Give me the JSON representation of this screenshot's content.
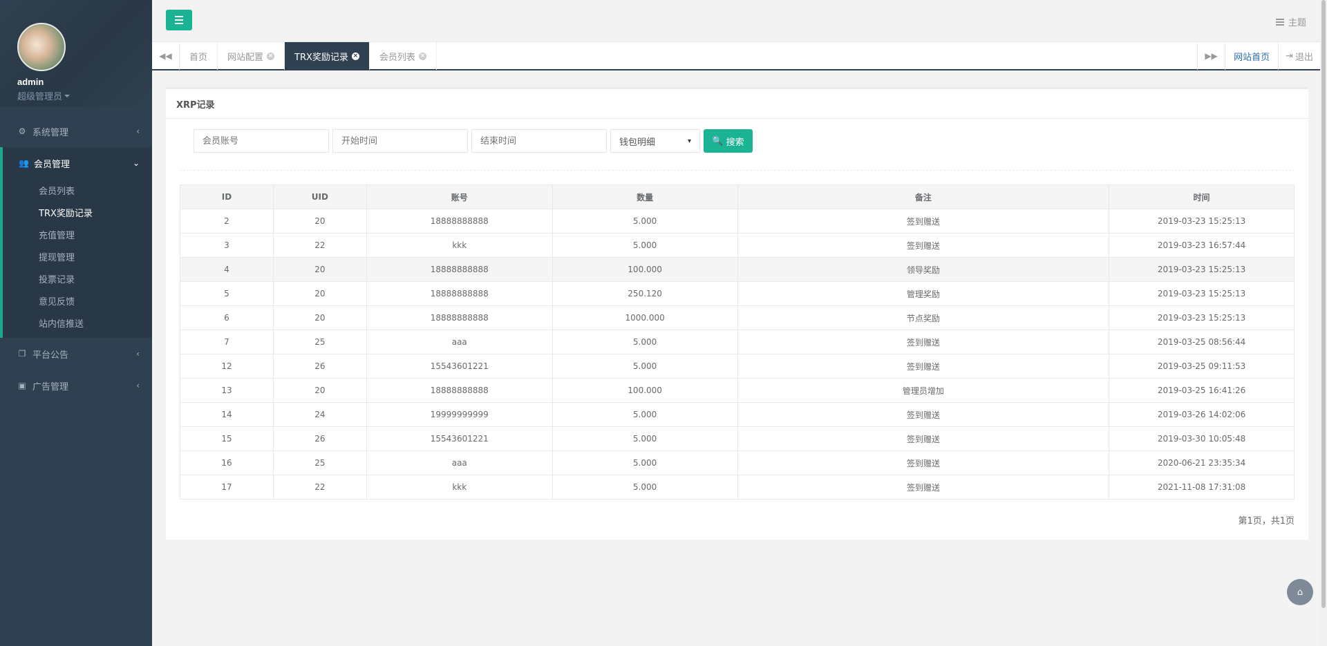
{
  "sidebar": {
    "username": "admin",
    "role": "超级管理员",
    "menu_system": "系统管理",
    "menu_member": "会员管理",
    "sub_items": [
      "会员列表",
      "TRX奖励记录",
      "充值管理",
      "提现管理",
      "投票记录",
      "意见反馈",
      "站内信推送"
    ],
    "menu_notice": "平台公告",
    "menu_ads": "广告管理"
  },
  "header": {
    "theme_label": "主题"
  },
  "tabs": {
    "items": [
      "首页",
      "网站配置",
      "TRX奖励记录",
      "会员列表"
    ],
    "active_index": 2,
    "home_link": "网站首页",
    "logout": "退出"
  },
  "panel": {
    "title": "XRP记录",
    "search_account_placeholder": "会员账号",
    "start_time_placeholder": "开始时间",
    "end_time_placeholder": "结束时间",
    "select_value": "钱包明细",
    "search_button": "搜索"
  },
  "table": {
    "headers": [
      "ID",
      "UID",
      "账号",
      "数量",
      "备注",
      "时间"
    ],
    "rows": [
      [
        "2",
        "20",
        "18888888888",
        "5.000",
        "签到赠送",
        "2019-03-23 15:25:13"
      ],
      [
        "3",
        "22",
        "kkk",
        "5.000",
        "签到赠送",
        "2019-03-23 16:57:44"
      ],
      [
        "4",
        "20",
        "18888888888",
        "100.000",
        "领导奖励",
        "2019-03-23 15:25:13"
      ],
      [
        "5",
        "20",
        "18888888888",
        "250.120",
        "管理奖励",
        "2019-03-23 15:25:13"
      ],
      [
        "6",
        "20",
        "18888888888",
        "1000.000",
        "节点奖励",
        "2019-03-23 15:25:13"
      ],
      [
        "7",
        "25",
        "aaa",
        "5.000",
        "签到赠送",
        "2019-03-25 08:56:44"
      ],
      [
        "12",
        "26",
        "15543601221",
        "5.000",
        "签到赠送",
        "2019-03-25 09:11:53"
      ],
      [
        "13",
        "20",
        "18888888888",
        "100.000",
        "管理员增加",
        "2019-03-25 16:41:26"
      ],
      [
        "14",
        "24",
        "19999999999",
        "5.000",
        "签到赠送",
        "2019-03-26 14:02:06"
      ],
      [
        "15",
        "26",
        "15543601221",
        "5.000",
        "签到赠送",
        "2019-03-30 10:05:48"
      ],
      [
        "16",
        "25",
        "aaa",
        "5.000",
        "签到赠送",
        "2020-06-21 23:35:34"
      ],
      [
        "17",
        "22",
        "kkk",
        "5.000",
        "签到赠送",
        "2021-11-08 17:31:08"
      ]
    ]
  },
  "pager": "第1页，共1页",
  "icons": {
    "menu": "menu-icon",
    "theme": "theme-icon",
    "search": "search-icon",
    "home": "home-icon"
  },
  "colors": {
    "sidebar": "#2f4050",
    "accent": "#1ab394",
    "tab_active": "#2f4050"
  }
}
